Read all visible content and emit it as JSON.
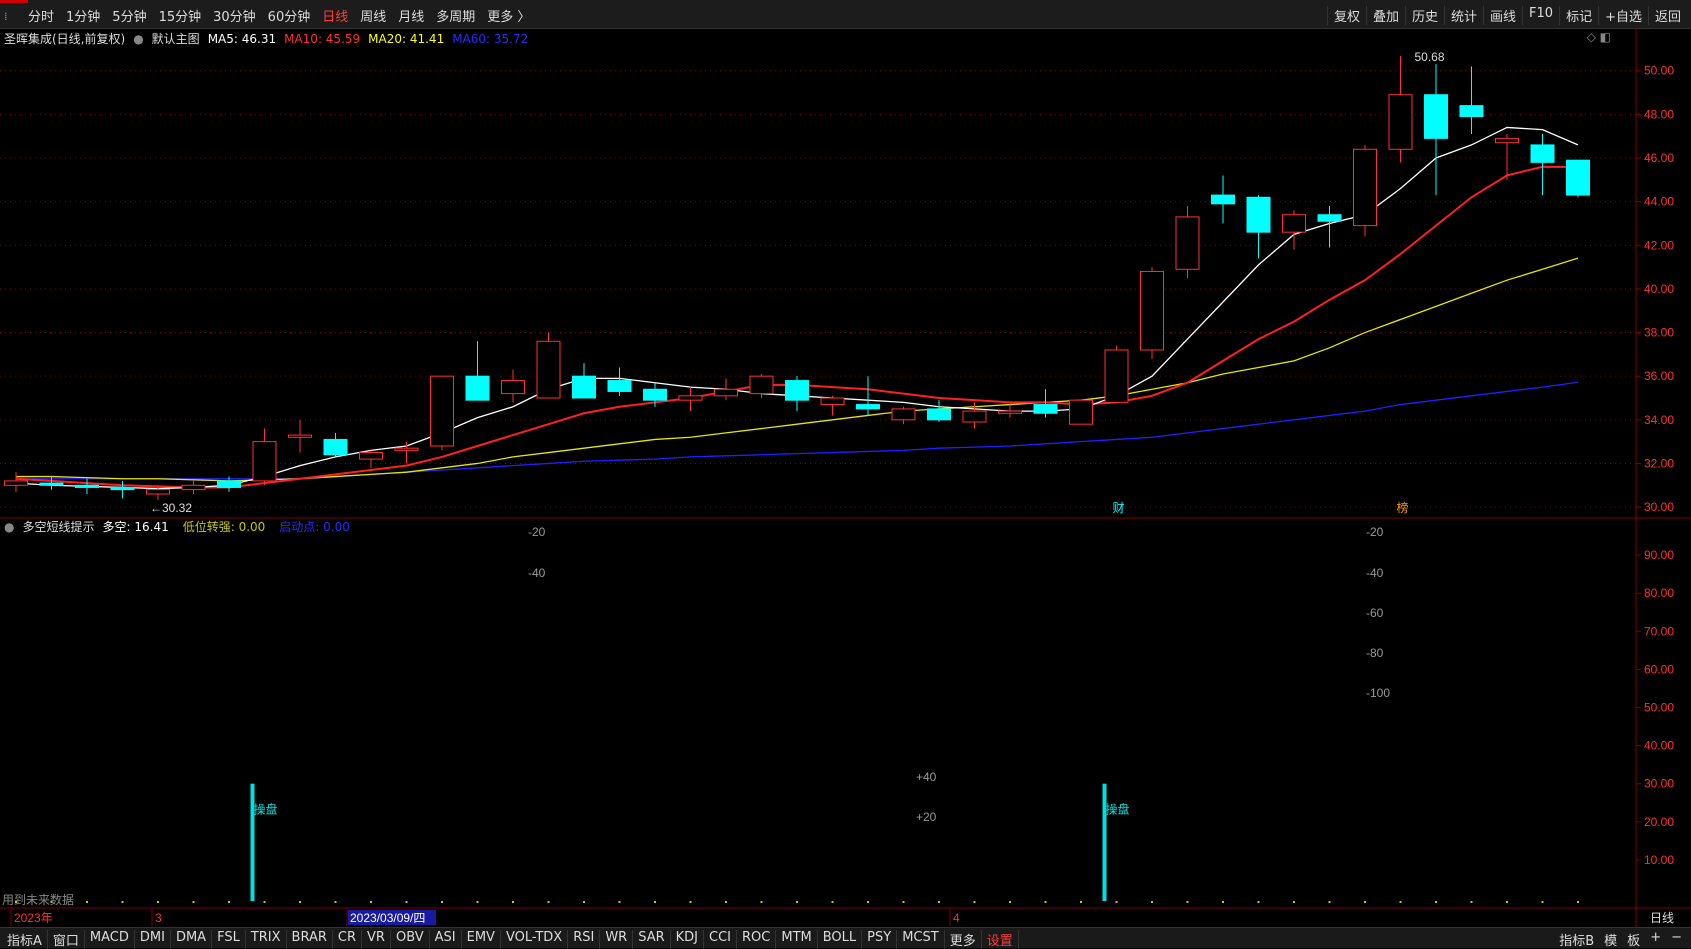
{
  "top_toolbar": {
    "period_tabs": [
      "分时",
      "1分钟",
      "5分钟",
      "15分钟",
      "30分钟",
      "60分钟",
      "日线",
      "周线",
      "月线",
      "多周期",
      "更多 〉"
    ],
    "active_tab": "日线",
    "right_tools": [
      "复权",
      "叠加",
      "历史",
      "统计",
      "画线",
      "F10",
      "标记",
      "+自选",
      "返回"
    ]
  },
  "main_chart": {
    "title": "圣晖集成(日线,前复权)",
    "template_label": "默认主图",
    "ma_legend": [
      {
        "label": "MA5: 46.31",
        "color": "#ffffff"
      },
      {
        "label": "MA10: 45.59",
        "color": "#ff3030"
      },
      {
        "label": "MA20: 41.41",
        "color": "#ffff00"
      },
      {
        "label": "MA60: 35.72",
        "color": "#2a2aff"
      }
    ],
    "markers": {
      "high": "50.68",
      "low": "30.32",
      "event_cai": "财",
      "event_bang": "榜"
    }
  },
  "sub_chart": {
    "title": "多空短线提示",
    "values": [
      {
        "label": "多空: 16.41",
        "color": "#ffffff"
      },
      {
        "label": "低位转强: 0.00",
        "color": "#c8c800"
      },
      {
        "label": "启动点: 0.00",
        "color": "#2a2aff"
      }
    ],
    "float_labels": [
      "-20",
      "-40",
      "-20",
      "-40",
      "-60",
      "-80",
      "-100",
      "+40",
      "+20"
    ],
    "signal_label": "操盘",
    "footer_note": "用到未来数据"
  },
  "time_axis": [
    "2023年",
    "3",
    "2023/03/09/四",
    "4"
  ],
  "bottom_toolbar": {
    "indicator_tabs": [
      "指标A",
      "窗口",
      "MACD",
      "DMI",
      "DMA",
      "FSL",
      "TRIX",
      "BRAR",
      "CR",
      "VR",
      "OBV",
      "ASI",
      "EMV",
      "VOL-TDX",
      "RSI",
      "WR",
      "SAR",
      "KDJ",
      "CCI",
      "ROC",
      "MTM",
      "BOLL",
      "PSY",
      "MCST",
      "更多",
      "设置"
    ],
    "right": [
      "指标B",
      "模",
      "板",
      "+",
      "−"
    ],
    "period_label": "日线"
  },
  "colors": {
    "up": "#ff3030",
    "down": "#00ffff",
    "ma5": "#ffffff",
    "ma10": "#ff2020",
    "ma20": "#e6e600",
    "ma60": "#2020ff",
    "grid": "#800000",
    "axis_text": "#ff3030"
  },
  "chart_data": {
    "type": "candlestick",
    "y_axis_ticks": [
      "50.00",
      "48.00",
      "46.00",
      "44.00",
      "42.00",
      "40.00",
      "38.00",
      "36.00",
      "34.00",
      "32.00",
      "30.00"
    ],
    "ylim": [
      29.5,
      51.5
    ],
    "candles": [
      {
        "o": 31.0,
        "h": 31.6,
        "l": 30.7,
        "c": 31.2
      },
      {
        "o": 31.1,
        "h": 31.4,
        "l": 30.8,
        "c": 31.0
      },
      {
        "o": 31.0,
        "h": 31.3,
        "l": 30.6,
        "c": 30.9
      },
      {
        "o": 30.9,
        "h": 31.2,
        "l": 30.4,
        "c": 30.8
      },
      {
        "o": 30.6,
        "h": 31.0,
        "l": 30.32,
        "c": 30.8
      },
      {
        "o": 30.8,
        "h": 31.2,
        "l": 30.6,
        "c": 31.0
      },
      {
        "o": 31.2,
        "h": 31.4,
        "l": 30.7,
        "c": 30.9
      },
      {
        "o": 31.2,
        "h": 33.6,
        "l": 31.0,
        "c": 33.0
      },
      {
        "o": 33.2,
        "h": 34.0,
        "l": 32.5,
        "c": 33.3
      },
      {
        "o": 33.1,
        "h": 33.4,
        "l": 32.3,
        "c": 32.4
      },
      {
        "o": 32.2,
        "h": 32.6,
        "l": 31.8,
        "c": 32.5
      },
      {
        "o": 32.6,
        "h": 33.0,
        "l": 32.0,
        "c": 32.7
      },
      {
        "o": 32.8,
        "h": 36.0,
        "l": 32.6,
        "c": 36.0
      },
      {
        "o": 36.0,
        "h": 37.6,
        "l": 35.0,
        "c": 34.9
      },
      {
        "o": 35.2,
        "h": 36.3,
        "l": 34.8,
        "c": 35.8
      },
      {
        "o": 35.0,
        "h": 38.0,
        "l": 35.0,
        "c": 37.6
      },
      {
        "o": 36.0,
        "h": 36.6,
        "l": 35.4,
        "c": 35.0
      },
      {
        "o": 35.8,
        "h": 36.4,
        "l": 35.1,
        "c": 35.3
      },
      {
        "o": 35.4,
        "h": 35.7,
        "l": 34.6,
        "c": 34.9
      },
      {
        "o": 34.9,
        "h": 35.5,
        "l": 34.4,
        "c": 35.1
      },
      {
        "o": 35.1,
        "h": 35.9,
        "l": 34.9,
        "c": 35.4
      },
      {
        "o": 35.2,
        "h": 36.1,
        "l": 35.0,
        "c": 36.0
      },
      {
        "o": 35.8,
        "h": 36.0,
        "l": 34.4,
        "c": 34.9
      },
      {
        "o": 34.7,
        "h": 35.1,
        "l": 34.2,
        "c": 35.0
      },
      {
        "o": 34.7,
        "h": 36.0,
        "l": 34.2,
        "c": 34.5
      },
      {
        "o": 34.0,
        "h": 34.6,
        "l": 33.8,
        "c": 34.5
      },
      {
        "o": 34.5,
        "h": 34.9,
        "l": 33.9,
        "c": 34.0
      },
      {
        "o": 33.9,
        "h": 34.8,
        "l": 33.6,
        "c": 34.4
      },
      {
        "o": 34.3,
        "h": 34.7,
        "l": 34.1,
        "c": 34.4
      },
      {
        "o": 34.7,
        "h": 35.4,
        "l": 34.1,
        "c": 34.3
      },
      {
        "o": 33.8,
        "h": 34.9,
        "l": 33.8,
        "c": 34.9
      },
      {
        "o": 34.8,
        "h": 37.4,
        "l": 34.8,
        "c": 37.2
      },
      {
        "o": 37.2,
        "h": 41.0,
        "l": 36.8,
        "c": 40.8
      },
      {
        "o": 40.9,
        "h": 43.8,
        "l": 40.5,
        "c": 43.3
      },
      {
        "o": 44.3,
        "h": 45.2,
        "l": 43.0,
        "c": 43.9
      },
      {
        "o": 44.2,
        "h": 44.3,
        "l": 41.4,
        "c": 42.6
      },
      {
        "o": 42.6,
        "h": 43.6,
        "l": 41.8,
        "c": 43.4
      },
      {
        "o": 43.4,
        "h": 43.8,
        "l": 41.9,
        "c": 43.1
      },
      {
        "o": 42.9,
        "h": 46.6,
        "l": 42.4,
        "c": 46.4
      },
      {
        "o": 46.4,
        "h": 50.68,
        "l": 45.8,
        "c": 48.9
      },
      {
        "o": 48.9,
        "h": 50.3,
        "l": 44.3,
        "c": 46.9
      },
      {
        "o": 48.4,
        "h": 50.2,
        "l": 47.1,
        "c": 47.9
      },
      {
        "o": 46.7,
        "h": 47.1,
        "l": 45.0,
        "c": 46.9
      },
      {
        "o": 46.6,
        "h": 47.1,
        "l": 44.3,
        "c": 45.8
      },
      {
        "o": 45.9,
        "h": 45.9,
        "l": 44.2,
        "c": 44.3
      }
    ],
    "ma5": [
      31.1,
      31.0,
      30.95,
      30.9,
      30.85,
      30.9,
      31.0,
      31.4,
      31.9,
      32.3,
      32.6,
      32.8,
      33.4,
      34.1,
      34.6,
      35.4,
      35.9,
      35.9,
      35.7,
      35.5,
      35.4,
      35.2,
      35.1,
      35.0,
      34.9,
      34.8,
      34.6,
      34.5,
      34.4,
      34.4,
      34.5,
      35.1,
      36.0,
      37.7,
      39.4,
      41.1,
      42.5,
      43.0,
      43.4,
      44.6,
      46.0,
      46.6,
      47.4,
      47.3,
      46.6
    ],
    "ma10": [
      31.3,
      31.2,
      31.1,
      31.0,
      30.95,
      30.9,
      30.9,
      31.1,
      31.3,
      31.5,
      31.7,
      31.9,
      32.3,
      32.8,
      33.3,
      33.8,
      34.3,
      34.6,
      34.8,
      35.0,
      35.3,
      35.6,
      35.6,
      35.5,
      35.4,
      35.2,
      35.0,
      34.9,
      34.8,
      34.8,
      34.7,
      34.8,
      35.1,
      35.7,
      36.7,
      37.7,
      38.5,
      39.5,
      40.4,
      41.6,
      42.9,
      44.2,
      45.2,
      45.6,
      45.59
    ],
    "ma20": [
      31.4,
      31.4,
      31.35,
      31.3,
      31.3,
      31.25,
      31.2,
      31.25,
      31.3,
      31.4,
      31.5,
      31.6,
      31.8,
      32.0,
      32.3,
      32.5,
      32.7,
      32.9,
      33.1,
      33.2,
      33.4,
      33.6,
      33.8,
      34.0,
      34.2,
      34.4,
      34.5,
      34.6,
      34.7,
      34.8,
      34.9,
      35.1,
      35.4,
      35.7,
      36.1,
      36.4,
      36.7,
      37.3,
      38.0,
      38.6,
      39.2,
      39.8,
      40.4,
      40.9,
      41.41
    ],
    "ma60": [
      31.3,
      31.3,
      31.3,
      31.3,
      31.3,
      31.3,
      31.3,
      31.3,
      31.3,
      31.4,
      31.5,
      31.6,
      31.7,
      31.8,
      31.9,
      32.0,
      32.1,
      32.15,
      32.2,
      32.3,
      32.35,
      32.4,
      32.45,
      32.5,
      32.55,
      32.6,
      32.7,
      32.75,
      32.8,
      32.9,
      33.0,
      33.1,
      33.2,
      33.4,
      33.6,
      33.8,
      34.0,
      34.2,
      34.4,
      34.7,
      34.9,
      35.1,
      35.3,
      35.5,
      35.72
    ],
    "sub_y_axis_ticks": [
      "90.00",
      "80.00",
      "70.00",
      "60.00",
      "50.00",
      "40.00",
      "30.00",
      "20.00",
      "10.00"
    ],
    "sub_ylim": [
      0,
      95
    ],
    "signal_bars": [
      {
        "index": 7,
        "value": 30
      },
      {
        "index": 31,
        "value": 30
      }
    ]
  }
}
